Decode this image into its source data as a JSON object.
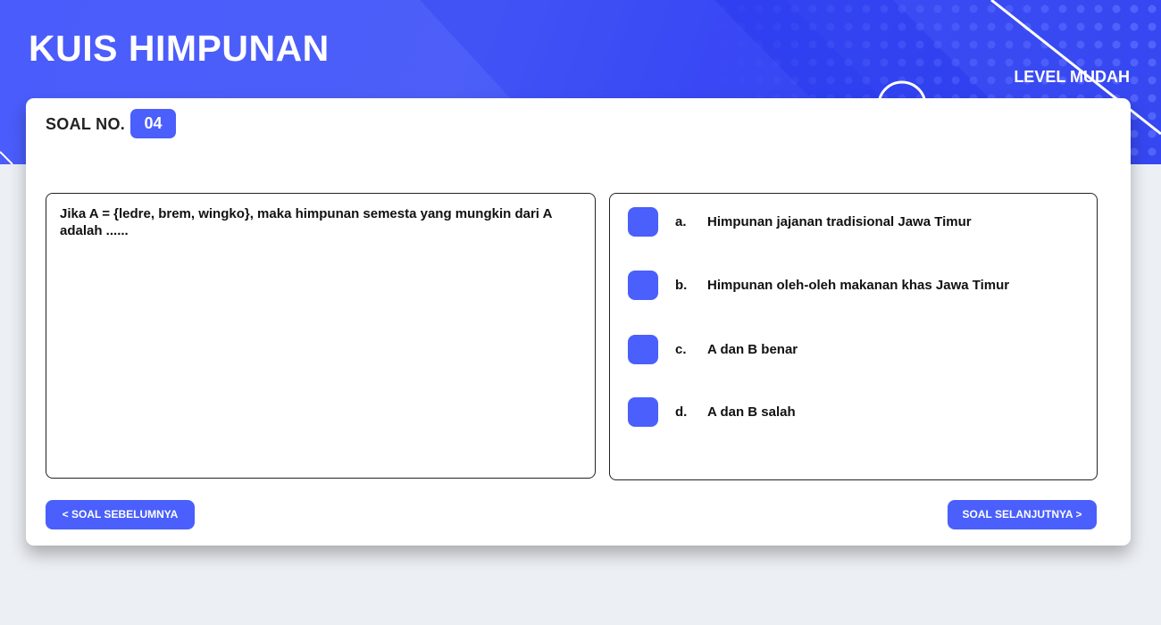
{
  "header": {
    "title": "KUIS HIMPUNAN",
    "level": "LEVEL MUDAH"
  },
  "question": {
    "label": "SOAL NO.",
    "number": "04",
    "text": "Jika A = {ledre, brem, wingko}, maka himpunan semesta yang mungkin dari A adalah ......"
  },
  "options": [
    {
      "letter": "a.",
      "text": "Himpunan jajanan tradisional Jawa Timur"
    },
    {
      "letter": "b.",
      "text": "Himpunan oleh-oleh makanan khas Jawa Timur"
    },
    {
      "letter": "c.",
      "text": "A dan B benar"
    },
    {
      "letter": "d.",
      "text": "A dan B salah"
    }
  ],
  "navigation": {
    "prev_label": "< SOAL SEBELUMNYA",
    "next_label": "SOAL SELANJUTNYA >"
  },
  "colors": {
    "accent": "#4a5ffb",
    "header_bg": "#4a5cfb",
    "page_bg": "#eceff4"
  }
}
